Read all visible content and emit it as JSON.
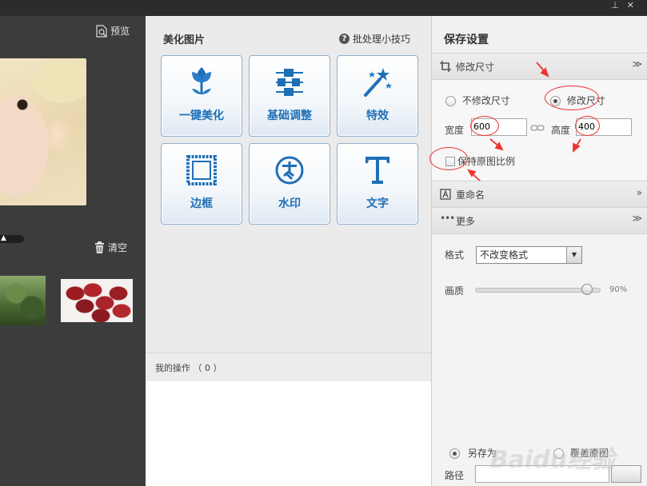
{
  "left": {
    "preview_label": "预览",
    "clear_label": "清空"
  },
  "middle": {
    "title": "美化图片",
    "tips_label": "批处理小技巧",
    "tiles": [
      {
        "label": "一键美化",
        "icon": "tulip-icon"
      },
      {
        "label": "基础调整",
        "icon": "sliders-icon"
      },
      {
        "label": "特效",
        "icon": "magic-wand-icon"
      },
      {
        "label": "边框",
        "icon": "frame-icon"
      },
      {
        "label": "水印",
        "icon": "watermark-seal-icon"
      },
      {
        "label": "文字",
        "icon": "text-t-icon"
      }
    ],
    "ops_label": "我的操作 （ 0 ）"
  },
  "right": {
    "title": "保存设置",
    "resize_section": {
      "label": "修改尺寸",
      "no_resize_label": "不修改尺寸",
      "resize_label": "修改尺寸",
      "width_label": "宽度",
      "width_value": "600",
      "height_label": "高度",
      "height_value": "400",
      "keep_ratio_label": "保持原图比例"
    },
    "rename_section": {
      "label": "重命名"
    },
    "more_section": {
      "label": "更多",
      "format_label": "格式",
      "format_value": "不改变格式",
      "quality_label": "画质",
      "quality_value": "90%",
      "quality_fraction": 0.9
    },
    "save_as_label": "另存为",
    "overwrite_label": "覆盖原图",
    "path_label": "路径"
  },
  "watermark_text": "Baidu经验",
  "accent_color": "#1f6fb6",
  "annotation_color": "#e33333"
}
